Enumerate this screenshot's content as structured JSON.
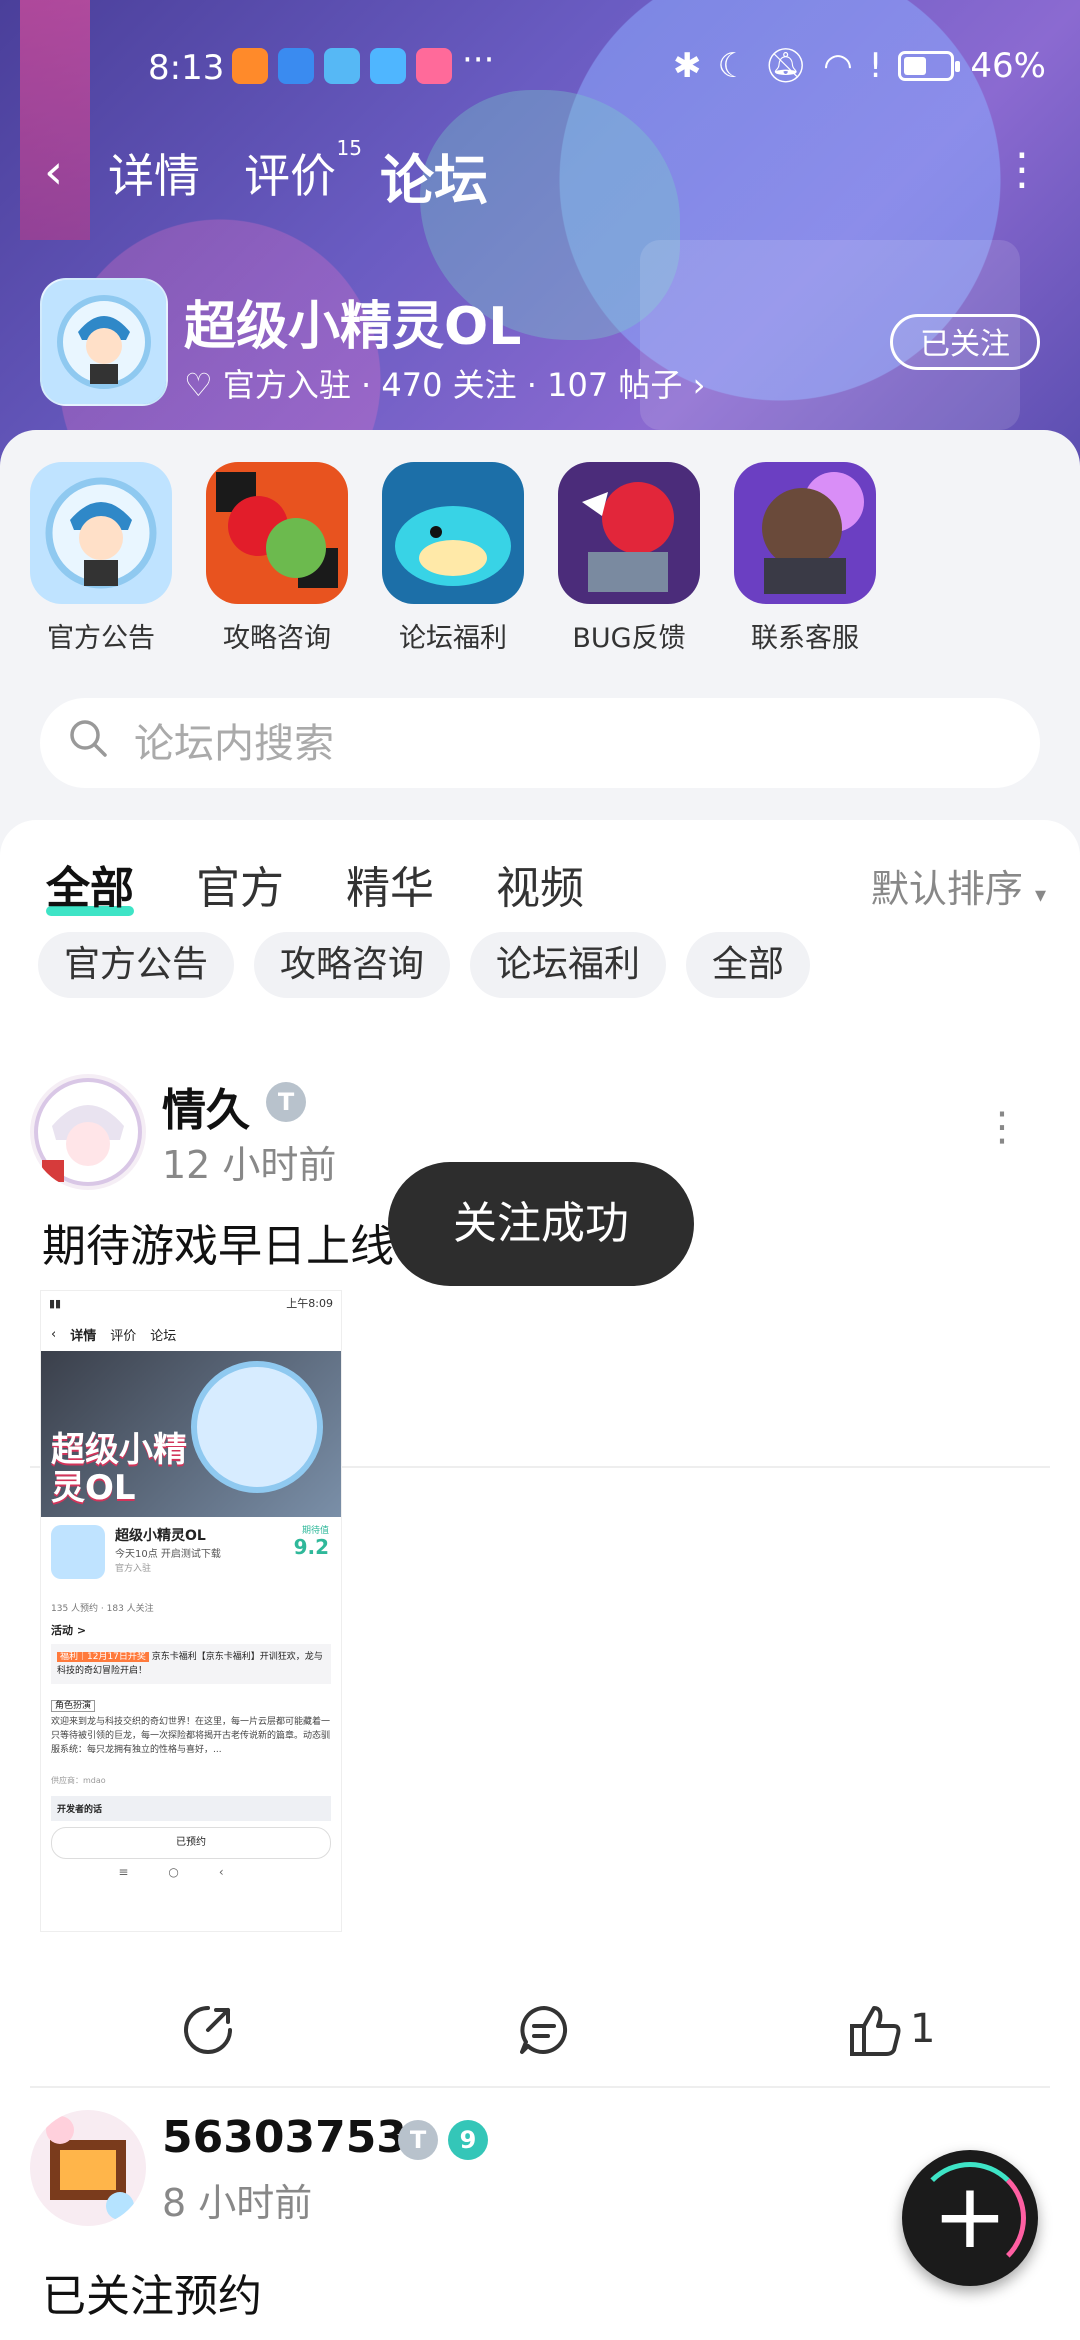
{
  "status": {
    "time": "8:13",
    "more": "···",
    "battery": "46%",
    "battery_level": 0.46
  },
  "nav": {
    "back": "‹",
    "detail": "详情",
    "review": "评价",
    "review_count": "15",
    "forum": "论坛",
    "menu": "⋮"
  },
  "game": {
    "title": "超级小精灵OL",
    "meta": "官方入驻 · 470 关注 · 107 帖子",
    "follow": "已关注"
  },
  "categories": [
    {
      "label": "官方公告"
    },
    {
      "label": "攻略咨询"
    },
    {
      "label": "论坛福利"
    },
    {
      "label": "BUG反馈"
    },
    {
      "label": "联系客服"
    }
  ],
  "search": {
    "placeholder": "论坛内搜索"
  },
  "tabs": [
    "全部",
    "官方",
    "精华",
    "视频"
  ],
  "sort": "默认排序",
  "chips": [
    "官方公告",
    "攻略咨询",
    "论坛福利",
    "全部"
  ],
  "posts": [
    {
      "user": "情久",
      "time": "12 小时前",
      "text": "期待游戏早日上线",
      "likes": "1",
      "screenshot": {
        "time": "上午8:09",
        "nav": [
          "详情",
          "评价",
          "论坛"
        ],
        "banner": "超级小精灵OL",
        "game": "超级小精灵OL",
        "sub": "今天10点 开启测试下载",
        "official": "官方入驻",
        "score_label": "期待值",
        "score": "9.2",
        "stats": "135 人预约 · 183 人关注",
        "activity": "活动 >",
        "activity_tag": "福利｜12月17日开奖",
        "activity_text": "京东卡福利【京东卡福利】开训狂欢，龙与科技的奇幻冒险开启！",
        "intro_tag": "角色扮演",
        "intro": "欢迎来到龙与科技交织的奇幻世界！在这里，每一片云层都可能藏着一只等待被引领的巨龙，每一次探险都将揭开古老传说新的篇章。动态驯服系统：每只龙拥有独立的性格与喜好，...",
        "dev": "供应商：mdao",
        "dev_note": "开发者的话",
        "reserved": "已预约"
      }
    },
    {
      "user": "56303753",
      "time": "8 小时前",
      "text": "已关注预约",
      "level": "9"
    }
  ],
  "toast": "关注成功",
  "fab": "+"
}
